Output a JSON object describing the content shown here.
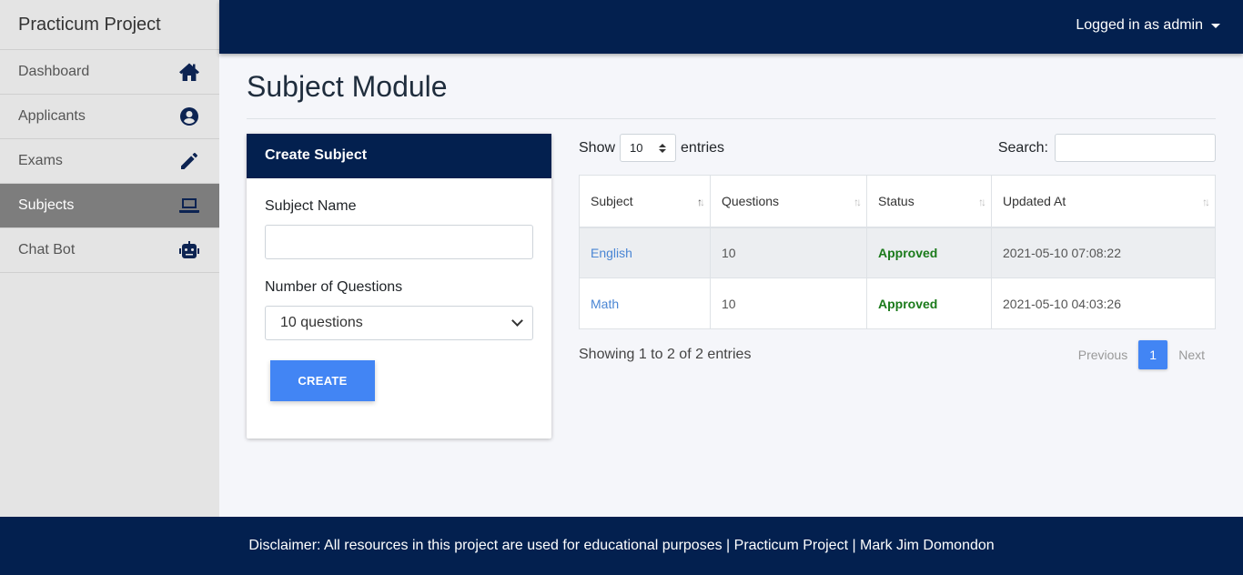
{
  "sidebar": {
    "brand": "Practicum Project",
    "items": [
      {
        "label": "Dashboard",
        "icon": "home-icon"
      },
      {
        "label": "Applicants",
        "icon": "user-circle-icon"
      },
      {
        "label": "Exams",
        "icon": "pencil-icon"
      },
      {
        "label": "Subjects",
        "icon": "laptop-icon",
        "active": true
      },
      {
        "label": "Chat Bot",
        "icon": "robot-icon"
      }
    ]
  },
  "topbar": {
    "user_label": "Logged in as admin"
  },
  "page": {
    "title": "Subject Module"
  },
  "create_card": {
    "header": "Create Subject",
    "subject_name_label": "Subject Name",
    "subject_name_value": "",
    "questions_label": "Number of Questions",
    "questions_selected": "10 questions",
    "create_button": "CREATE"
  },
  "table": {
    "show_label": "Show",
    "entries_label": "entries",
    "length_value": "10",
    "search_label": "Search:",
    "search_value": "",
    "columns": [
      "Subject",
      "Questions",
      "Status",
      "Updated At"
    ],
    "rows": [
      {
        "subject": "English",
        "questions": "10",
        "status": "Approved",
        "updated_at": "2021-05-10 07:08:22"
      },
      {
        "subject": "Math",
        "questions": "10",
        "status": "Approved",
        "updated_at": "2021-05-10 04:03:26"
      }
    ],
    "info": "Showing 1 to 2 of 2 entries",
    "pager": {
      "previous": "Previous",
      "current": "1",
      "next": "Next"
    }
  },
  "footer": {
    "text": "Disclaimer: All resources in this project are used for educational purposes | Practicum Project | Mark Jim Domondon"
  },
  "colors": {
    "navy": "#03204f",
    "primary": "#4285f4",
    "approved": "#1a7a1a",
    "link": "#4a86d4"
  }
}
